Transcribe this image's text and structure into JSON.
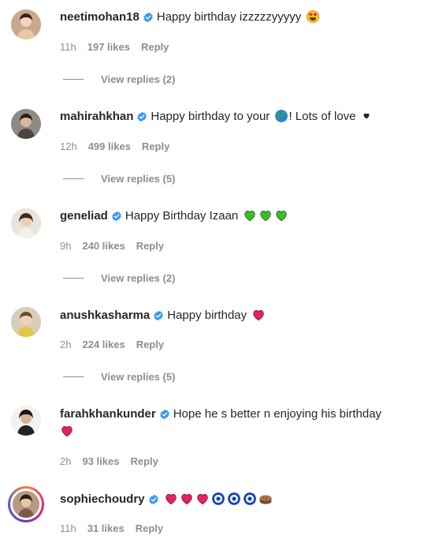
{
  "comments": [
    {
      "username": "neetimohan18",
      "text": "Happy birthday izzzzzyyyyy",
      "emojis": [
        "heart-eyes-emoji"
      ],
      "time": "11h",
      "likes": "197 likes",
      "reply": "Reply",
      "view_replies": "View replies (2)"
    },
    {
      "username": "mahirahkhan",
      "text": "Happy birthday to your",
      "text_after": "! Lots of love",
      "emojis": [
        "globe-emoji",
        "small-black-heart-emoji"
      ],
      "time": "12h",
      "likes": "499 likes",
      "reply": "Reply",
      "view_replies": "View replies (5)"
    },
    {
      "username": "geneliad",
      "text": "Happy Birthday Izaan",
      "emojis": [
        "green-heart-emoji",
        "green-heart-emoji",
        "green-heart-emoji"
      ],
      "time": "9h",
      "likes": "240 likes",
      "reply": "Reply",
      "view_replies": "View replies (2)"
    },
    {
      "username": "anushkasharma",
      "text": "Happy birthday",
      "emojis": [
        "red-heart-emoji"
      ],
      "time": "2h",
      "likes": "224 likes",
      "reply": "Reply",
      "view_replies": "View replies (5)"
    },
    {
      "username": "farahkhankunder",
      "text": "Hope he s better n enjoying his birthday",
      "emojis": [
        "red-heart-emoji"
      ],
      "time": "2h",
      "likes": "93 likes",
      "reply": "Reply"
    },
    {
      "username": "sophiechoudry",
      "text": "",
      "emojis": [
        "red-heart-emoji",
        "red-heart-emoji",
        "red-heart-emoji",
        "nazar-amulet-emoji",
        "nazar-amulet-emoji",
        "nazar-amulet-emoji",
        "cake-emoji"
      ],
      "time": "11h",
      "likes": "31 likes",
      "reply": "Reply"
    }
  ],
  "colors": {
    "verified_blue": "#3897f0",
    "muted_text": "#8e8e8e",
    "primary_text": "#262626",
    "red_heart": "#e0245e",
    "green_heart": "#3cba2c"
  }
}
